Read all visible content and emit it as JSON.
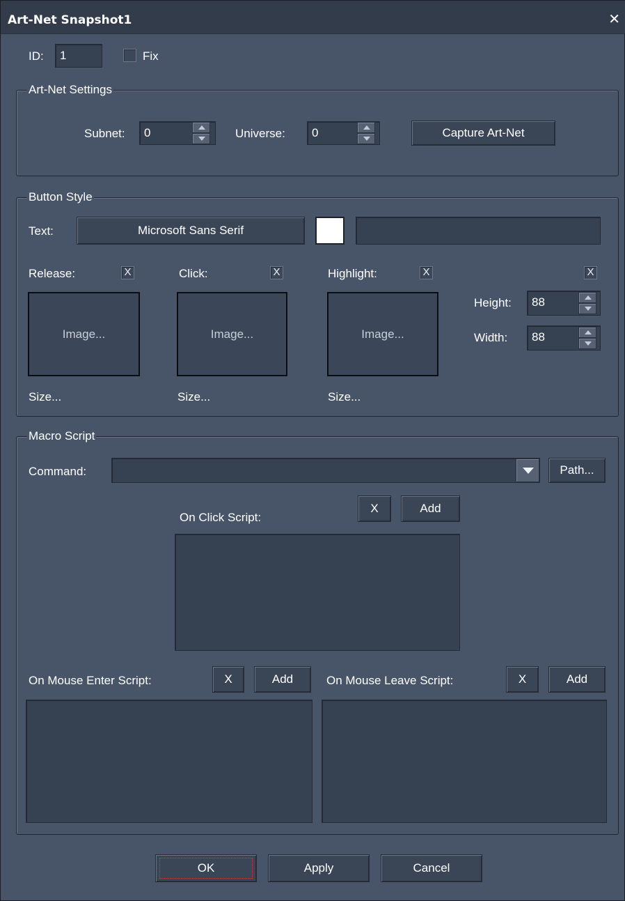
{
  "window": {
    "title": "Art-Net Snapshot1"
  },
  "id_row": {
    "id_label": "ID:",
    "id_value": "1",
    "fix_label": "Fix"
  },
  "artnet": {
    "group_title": "Art-Net Settings",
    "subnet_label": "Subnet:",
    "subnet_value": "0",
    "universe_label": "Universe:",
    "universe_value": "0",
    "capture_label": "Capture Art-Net"
  },
  "button_style": {
    "group_title": "Button Style",
    "text_label": "Text:",
    "font_button": "Microsoft Sans Serif",
    "text_value": "",
    "text_color": "#ffffff",
    "release_label": "Release:",
    "click_label": "Click:",
    "highlight_label": "Highlight:",
    "check_mark": "X",
    "image_placeholder": "Image...",
    "size_label": "Size...",
    "height_label": "Height:",
    "height_value": "88",
    "width_label": "Width:",
    "width_value": "88"
  },
  "macro": {
    "group_title": "Macro Script",
    "command_label": "Command:",
    "command_value": "",
    "path_label": "Path...",
    "on_click_label": "On Click Script:",
    "on_enter_label": "On Mouse Enter Script:",
    "on_leave_label": "On Mouse Leave Script:",
    "clear_label": "X",
    "add_label": "Add"
  },
  "footer": {
    "ok_label": "OK",
    "apply_label": "Apply",
    "cancel_label": "Cancel"
  },
  "colors": {
    "background": "#485569",
    "titlebar": "#323c4b",
    "field": "#364152"
  }
}
